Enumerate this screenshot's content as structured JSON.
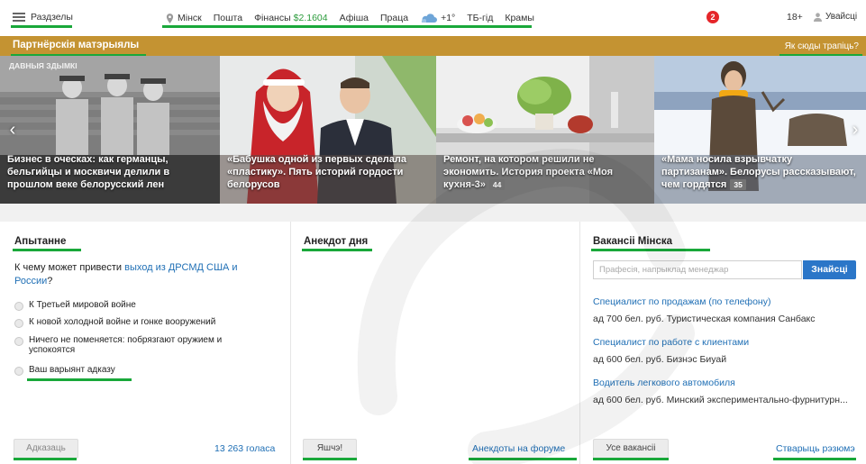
{
  "topbar": {
    "menu_label": "Раздзелы",
    "nav": [
      {
        "label": "Мінск",
        "icon": "location-pin-icon"
      },
      {
        "label": "Пошта"
      },
      {
        "label": "Фінансы",
        "extra": "$2.1604"
      },
      {
        "label": "Афіша"
      },
      {
        "label": "Праца"
      },
      {
        "label": "+1°",
        "icon": "weather-cloud-icon"
      },
      {
        "label": "ТБ-гід"
      },
      {
        "label": "Крамы"
      }
    ],
    "notifications": "2",
    "age_badge": "18+",
    "login_label": "Увайсці"
  },
  "partner": {
    "title": "Партнёрскія матэрыялы",
    "link": "Як сюды трапіць?"
  },
  "slides": [
    {
      "caption": "Бизнес в оческах: как германцы, бельгийцы и москвичи делили в прошлом веке белорусский лен",
      "badge": "",
      "top_text": "ДАВНЫЯ ЗДЫМКІ"
    },
    {
      "caption": "«Бабушка одной из первых сделала «пластику». Пять историй гордости белорусов",
      "badge": ""
    },
    {
      "caption": "Ремонт, на котором решили не экономить. История проекта «Моя кухня-3»",
      "badge": "44"
    },
    {
      "caption": "«Мама носила взрывчатку партизанам». Белорусы рассказывают, чем гордятся",
      "badge": "35"
    }
  ],
  "poll": {
    "title": "Апытанне",
    "question_prefix": "К чему может привести ",
    "question_link": "выход из ДРСМД США и России",
    "question_suffix": "?",
    "options": [
      "К Третьей мировой войне",
      "К новой холодной войне и гонке вооружений",
      "Ничего не поменяется: побрязгают оружием и успокоятся",
      "Ваш варыянт адказу"
    ],
    "answer_button": "Адказаць",
    "votes": "13 263 голаса"
  },
  "joke": {
    "title": "Анекдот дня",
    "more_button": "Яшчэ!",
    "forum_link": "Анекдоты на форуме"
  },
  "jobs": {
    "title": "Вакансіі Мінска",
    "search_placeholder": "Прафесія, напрыклад менеджар",
    "search_button": "Знайсці",
    "items": [
      {
        "title": "Специалист по продажам (по телефону)",
        "info": "ад 700 бел. руб. Туристическая компания Санбакс"
      },
      {
        "title": "Специалист по работе с клиентами",
        "info": "ад 600 бел. руб. Бизнэс Биуай"
      },
      {
        "title": "Водитель легкового автомобиля",
        "info": "ад 600 бел. руб. Минский экспериментально-фурнитурн..."
      }
    ],
    "all_button": "Усе вакансіі",
    "resume_link": "Стварыць рэзюмэ"
  },
  "colors": {
    "partner_bar": "#c49332",
    "accent_green": "#19a83a",
    "link_blue": "#1f6fb5",
    "button_blue": "#2b76c8",
    "notification_red": "#e5262a"
  }
}
